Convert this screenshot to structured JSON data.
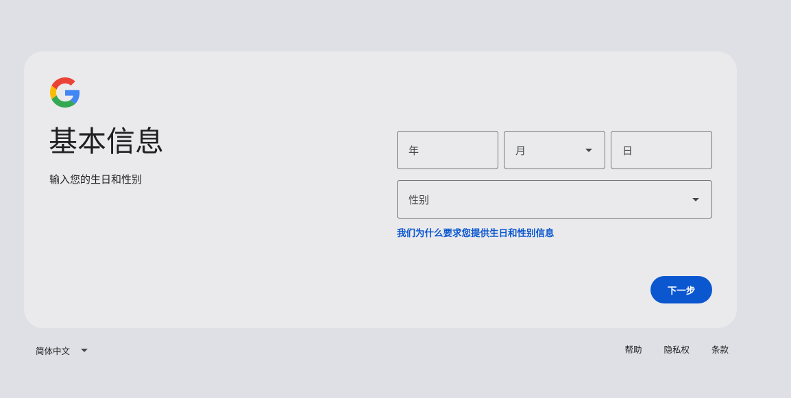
{
  "brand": {
    "logo_icon": "google-g-icon",
    "colors": {
      "blue": "#4285F4",
      "red": "#EA4335",
      "yellow": "#FBBC05",
      "green": "#34A853",
      "accent": "#0b57d0"
    }
  },
  "header": {
    "title": "基本信息",
    "subtitle": "输入您的生日和性别"
  },
  "form": {
    "year": {
      "label": "年",
      "value": ""
    },
    "month": {
      "label": "月",
      "value": ""
    },
    "day": {
      "label": "日",
      "value": ""
    },
    "gender": {
      "label": "性别",
      "value": ""
    },
    "why_link": "我们为什么要求您提供生日和性别信息",
    "next_label": "下一步"
  },
  "footer": {
    "language": "简体中文",
    "links": {
      "help": "帮助",
      "privacy": "隐私权",
      "terms": "条款"
    }
  }
}
